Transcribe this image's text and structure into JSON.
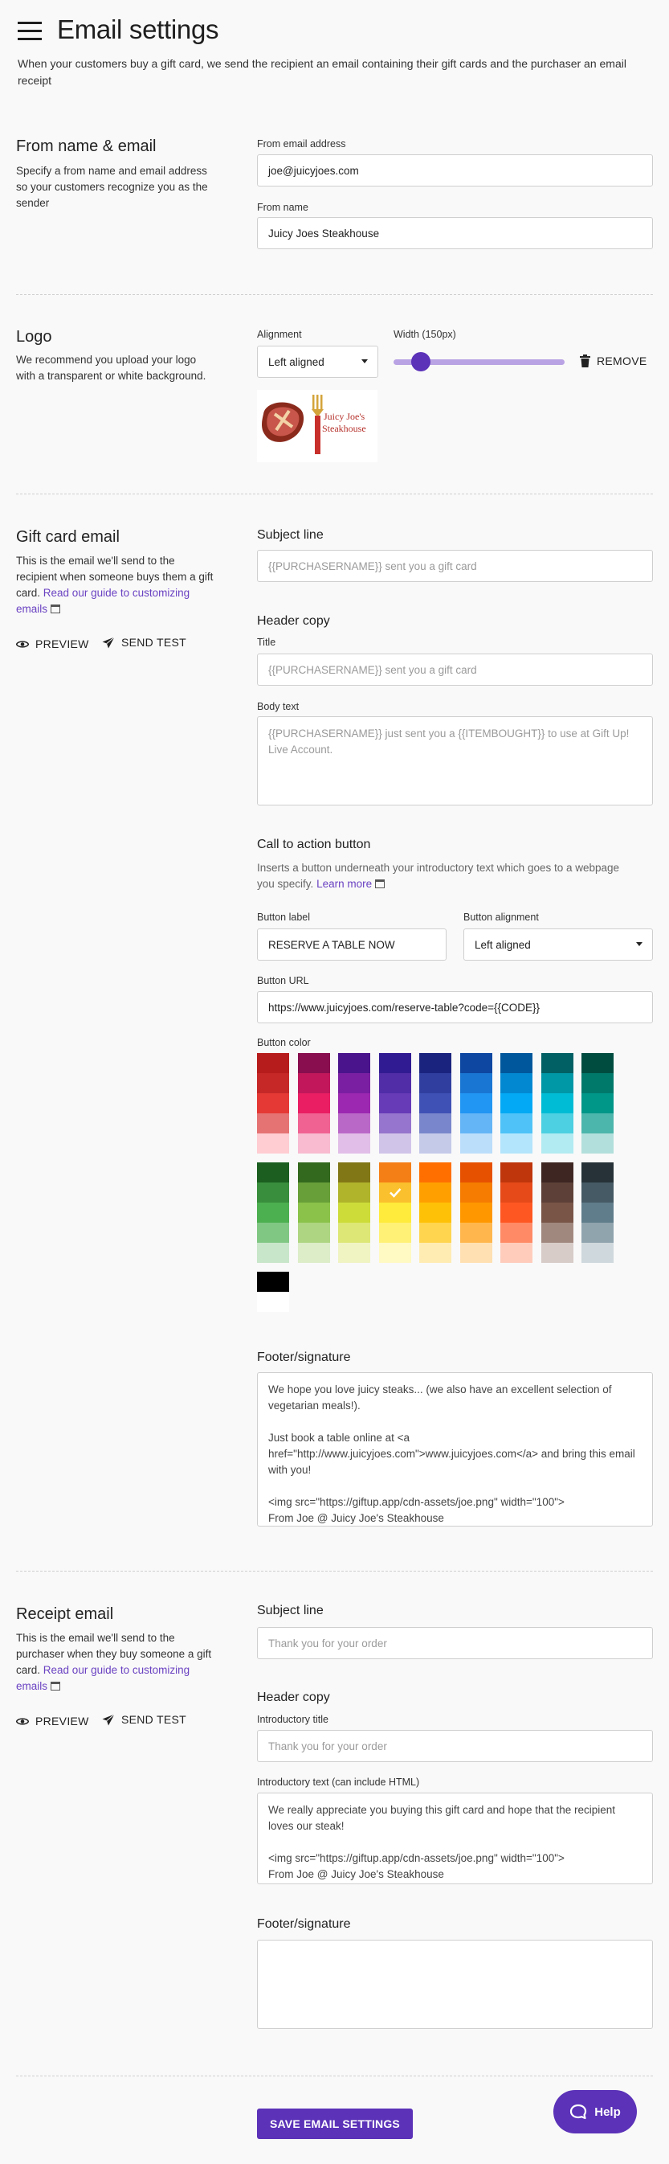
{
  "header": {
    "title": "Email settings",
    "intro": "When your customers buy a gift card, we send the recipient an email containing their gift cards and the purchaser an email receipt"
  },
  "from": {
    "heading": "From name & email",
    "description": "Specify a from name and email address so your customers recognize you as the sender",
    "email_label": "From email address",
    "email_value": "joe@juicyjoes.com",
    "name_label": "From name",
    "name_value": "Juicy Joes Steakhouse"
  },
  "logo": {
    "heading": "Logo",
    "description": "We recommend you upload your logo with a transparent or white background.",
    "alignment_label": "Alignment",
    "alignment_value": "Left aligned",
    "width_label": "Width (150px)",
    "width_fraction": 0.16,
    "remove_label": "REMOVE",
    "logo_text_line1": "Juicy Joe's",
    "logo_text_line2": "Steakhouse"
  },
  "gift_email": {
    "heading": "Gift card email",
    "description": "This is the email we'll send to the recipient when someone buys them a gift card.",
    "guide_link": "Read our guide to customizing emails",
    "preview_label": "PREVIEW",
    "send_test_label": "SEND TEST",
    "subject_label": "Subject line",
    "subject_placeholder": "{{PURCHASERNAME}} sent you a gift card",
    "header_copy_label": "Header copy",
    "title_label": "Title",
    "title_placeholder": "{{PURCHASERNAME}} sent you a gift card",
    "body_label": "Body text",
    "body_placeholder": "{{PURCHASERNAME}} just sent you a {{ITEMBOUGHT}} to use at Gift Up! Live Account.",
    "cta_heading": "Call to action button",
    "cta_description": "Inserts a button underneath your introductory text which goes to a webpage you specify.",
    "cta_learn_more": "Learn more",
    "button_label_label": "Button label",
    "button_label_value": "RESERVE A TABLE NOW",
    "button_alignment_label": "Button alignment",
    "button_alignment_value": "Left aligned",
    "button_url_label": "Button URL",
    "button_url_value": "https://www.juicyjoes.com/reserve-table?code={{CODE}}",
    "button_color_label": "Button color",
    "selected_color": "#fbc02d",
    "palette_top": [
      [
        "#b71c1c",
        "#c62828",
        "#e53935",
        "#e57373",
        "#ffcdd2"
      ],
      [
        "#880e4f",
        "#c2185b",
        "#e91e63",
        "#f06292",
        "#f8bbd0"
      ],
      [
        "#4a148c",
        "#7b1fa2",
        "#9c27b0",
        "#ba68c8",
        "#e1bee7"
      ],
      [
        "#311b92",
        "#512da8",
        "#673ab7",
        "#9575cd",
        "#d1c4e9"
      ],
      [
        "#1a237e",
        "#303f9f",
        "#3f51b5",
        "#7986cb",
        "#c5cae9"
      ],
      [
        "#0d47a1",
        "#1976d2",
        "#2196f3",
        "#64b5f6",
        "#bbdefb"
      ],
      [
        "#01579b",
        "#0288d1",
        "#03a9f4",
        "#4fc3f7",
        "#b3e5fc"
      ],
      [
        "#006064",
        "#0097a7",
        "#00bcd4",
        "#4dd0e1",
        "#b2ebf2"
      ],
      [
        "#004d40",
        "#00796b",
        "#009688",
        "#4db6ac",
        "#b2dfdb"
      ]
    ],
    "palette_bottom": [
      [
        "#1b5e20",
        "#388e3c",
        "#4caf50",
        "#81c784",
        "#c8e6c9"
      ],
      [
        "#33691e",
        "#689f38",
        "#8bc34a",
        "#aed581",
        "#dcedc8"
      ],
      [
        "#827717",
        "#afb42b",
        "#cddc39",
        "#dce775",
        "#f0f4c3"
      ],
      [
        "#f57f17",
        "#fbc02d",
        "#ffeb3b",
        "#fff176",
        "#fff9c4"
      ],
      [
        "#ff6f00",
        "#ffa000",
        "#ffc107",
        "#ffd54f",
        "#ffecb3"
      ],
      [
        "#e65100",
        "#f57c00",
        "#ff9800",
        "#ffb74d",
        "#ffe0b2"
      ],
      [
        "#bf360c",
        "#e64a19",
        "#ff5722",
        "#ff8a65",
        "#ffccbc"
      ],
      [
        "#3e2723",
        "#5d4037",
        "#795548",
        "#a1887f",
        "#d7ccc8"
      ],
      [
        "#263238",
        "#455a64",
        "#607d8b",
        "#90a4ae",
        "#cfd8dc"
      ]
    ],
    "palette_extra": [
      "#000000",
      "#ffffff"
    ],
    "footer_label": "Footer/signature",
    "footer_value": "We hope you love juicy steaks... (we also have an excellent selection of vegetarian meals!).\n\nJust book a table online at <a href=\"http://www.juicyjoes.com\">www.juicyjoes.com</a> and bring this email with you!\n\n<img src=\"https://giftup.app/cdn-assets/joe.png\" width=\"100\">\nFrom Joe @ Juicy Joe's Steakhouse"
  },
  "receipt_email": {
    "heading": "Receipt email",
    "description": "This is the email we'll send to the purchaser when they buy someone a gift card.",
    "guide_link": "Read our guide to customizing emails",
    "preview_label": "PREVIEW",
    "send_test_label": "SEND TEST",
    "subject_label": "Subject line",
    "subject_placeholder": "Thank you for your order",
    "header_copy_label": "Header copy",
    "intro_title_label": "Introductory title",
    "intro_title_placeholder": "Thank you for your order",
    "intro_text_label": "Introductory text (can include HTML)",
    "intro_text_value": "We really appreciate you buying this gift card and hope that the recipient loves our steak!\n\n<img src=\"https://giftup.app/cdn-assets/joe.png\" width=\"100\">\nFrom Joe @ Juicy Joe's Steakhouse",
    "footer_label": "Footer/signature",
    "footer_value": ""
  },
  "save_label": "SAVE EMAIL SETTINGS",
  "help_label": "Help",
  "colors": {
    "accent": "#5b32b8",
    "link": "#6a42c2"
  }
}
